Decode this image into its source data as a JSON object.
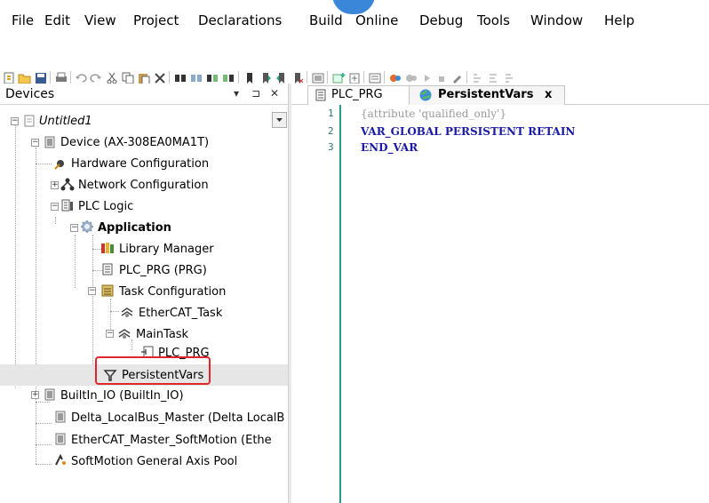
{
  "menu": {
    "items": [
      "File",
      "Edit",
      "View",
      "Project",
      "Declarations",
      "Build",
      "Online",
      "Debug",
      "Tools",
      "Window",
      "Help"
    ]
  },
  "toolbar": {
    "icons": [
      "new-project-icon",
      "open-project-icon",
      "save-icon",
      "print-icon",
      "undo-icon",
      "redo-icon",
      "cut-icon",
      "copy-icon",
      "paste-icon",
      "delete-icon",
      "find-icon",
      "replace-icon",
      "find-next-icon",
      "find-previous-icon",
      "bookmark-icon",
      "bookmark-next-icon",
      "bookmark-prev-icon",
      "bookmark-clear-icon",
      "device-icon",
      "add-object-icon",
      "import-icon",
      "library-icon",
      "login-icon",
      "logout-icon",
      "run-icon",
      "stop-icon",
      "reset-icon",
      "step-over-icon",
      "step-into-icon",
      "step-out-icon"
    ]
  },
  "devices_panel": {
    "title": "Devices",
    "pin_glyph": "▾ ⊐ ✕",
    "tree": [
      {
        "label": "Untitled1",
        "italic": true,
        "icon": "project-icon",
        "level": 0
      },
      {
        "label": "Device (AX-308EA0MA1T)",
        "icon": "device-icon",
        "level": 1
      },
      {
        "label": "Hardware Configuration",
        "icon": "hardware-config-icon",
        "level": 2
      },
      {
        "label": "Network Configuration",
        "icon": "network-config-icon",
        "level": 2
      },
      {
        "label": "PLC Logic",
        "icon": "plc-logic-icon",
        "level": 2
      },
      {
        "label": "Application",
        "bold": true,
        "icon": "application-gear-icon",
        "level": 3
      },
      {
        "label": "Library Manager",
        "icon": "library-manager-icon",
        "level": 4
      },
      {
        "label": "PLC_PRG (PRG)",
        "icon": "pou-icon",
        "level": 4
      },
      {
        "label": "Task Configuration",
        "icon": "task-config-icon",
        "level": 4
      },
      {
        "label": "EtherCAT_Task",
        "icon": "task-icon",
        "level": 5
      },
      {
        "label": "MainTask",
        "icon": "task-icon",
        "level": 5
      },
      {
        "label": "PLC_PRG",
        "icon": "program-call-icon",
        "level": 6
      },
      {
        "label": "PersistentVars",
        "icon": "persistent-vars-icon",
        "level": 4
      },
      {
        "label": "BuiltIn_IO (BuiltIn_IO)",
        "icon": "device-icon",
        "level": 2
      },
      {
        "label": "Delta_LocalBus_Master (Delta LocalB",
        "icon": "device-icon",
        "level": 2
      },
      {
        "label": "EtherCAT_Master_SoftMotion (Ethe",
        "icon": "device-icon",
        "level": 2
      },
      {
        "label": "SoftMotion General Axis Pool",
        "icon": "axis-pool-icon",
        "level": 2
      }
    ]
  },
  "editor": {
    "tabs": [
      {
        "label": "PLC_PRG",
        "active": false
      },
      {
        "label": "PersistentVars",
        "active": true,
        "close": "x"
      }
    ],
    "line_numbers": [
      "1",
      "2",
      "3"
    ],
    "lines": [
      {
        "text": "{attribute 'qualified_only'}",
        "color": "#9a9a9a"
      },
      {
        "text": "VAR_GLOBAL PERSISTENT RETAIN",
        "color": "#1a1aa6"
      },
      {
        "text": "END_VAR",
        "color": "#1a1aa6"
      }
    ]
  },
  "colors": {
    "highlight": "#e0262b",
    "accent": "#3a86d8",
    "gutter": "#2a9a8a"
  }
}
